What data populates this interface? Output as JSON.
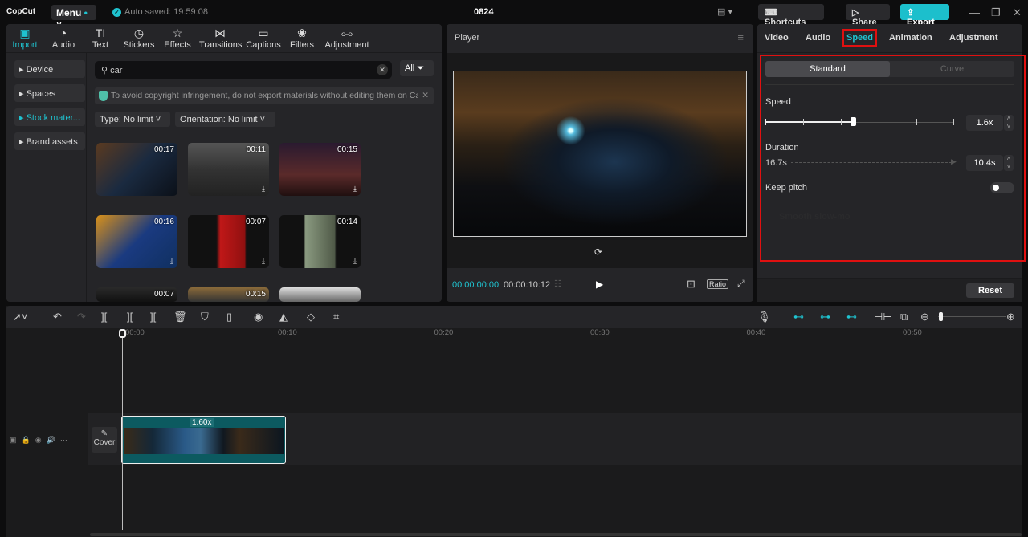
{
  "app": {
    "logo": "CopCut",
    "menu": "Menu",
    "autosave": "Auto saved: 19:59:08",
    "title": "0824",
    "shortcuts": "Shortcuts",
    "share": "Share",
    "export": "Export"
  },
  "tabs": [
    {
      "label": "Import",
      "icon": "import-icon"
    },
    {
      "label": "Audio",
      "icon": "audio-icon"
    },
    {
      "label": "Text",
      "icon": "text-icon"
    },
    {
      "label": "Stickers",
      "icon": "stickers-icon"
    },
    {
      "label": "Effects",
      "icon": "effects-icon"
    },
    {
      "label": "Transitions",
      "icon": "transitions-icon"
    },
    {
      "label": "Captions",
      "icon": "captions-icon"
    },
    {
      "label": "Filters",
      "icon": "filters-icon"
    },
    {
      "label": "Adjustment",
      "icon": "adjustment-icon"
    }
  ],
  "sidebar": [
    {
      "label": "Device"
    },
    {
      "label": "Spaces"
    },
    {
      "label": "Stock mater..."
    },
    {
      "label": "Brand assets"
    }
  ],
  "search": {
    "value": "car",
    "filter": "All"
  },
  "notice": "To avoid copyright infringement, do not export materials without editing them on Ca",
  "filters": {
    "type": "Type: No limit",
    "orientation": "Orientation: No limit"
  },
  "thumbs": [
    "00:17",
    "00:11",
    "00:15",
    "00:16",
    "00:07",
    "00:14",
    "00:07",
    "00:15",
    ""
  ],
  "player": {
    "title": "Player",
    "current": "00:00:00:00",
    "total": "00:00:10:12",
    "ratio": "Ratio"
  },
  "right_tabs": [
    "Video",
    "Audio",
    "Speed",
    "Animation",
    "Adjustment"
  ],
  "speed": {
    "mode_standard": "Standard",
    "mode_curve": "Curve",
    "speed_label": "Speed",
    "speed_value": "1.6x",
    "speed_fraction": 0.16,
    "duration_label": "Duration",
    "duration_original": "16.7s",
    "duration_value": "10.4s",
    "keep_pitch": "Keep pitch",
    "keep_pitch_on": false,
    "smooth": "Smooth slow-mo",
    "reset": "Reset"
  },
  "timeline": {
    "ticks": [
      "00:00",
      "00:10",
      "00:20",
      "00:30",
      "00:40",
      "00:50"
    ],
    "clip_speed": "1.60x",
    "cover": "Cover"
  }
}
